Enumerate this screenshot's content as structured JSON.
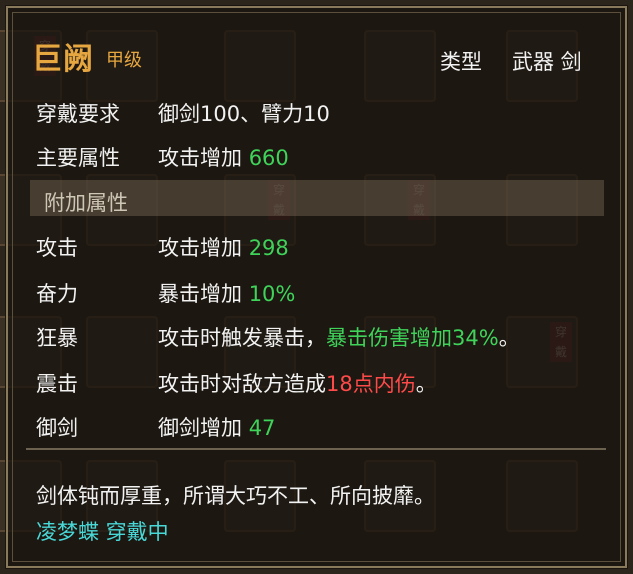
{
  "item": {
    "name": "巨阙",
    "grade": "甲级",
    "type_label": "类型",
    "type_value": "武器 剑"
  },
  "requirement": {
    "label": "穿戴要求",
    "value": "御剑100、臂力10"
  },
  "main_attr": {
    "label": "主要属性",
    "text": "攻击增加",
    "number": "660"
  },
  "bonus_section": {
    "label": "附加属性"
  },
  "bonus_attrs": [
    {
      "label": "攻击",
      "text": "攻击增加",
      "number": "298"
    },
    {
      "label": "奋力",
      "text": "暴击增加",
      "number": "10%"
    }
  ],
  "special_attrs": {
    "kuangbao": {
      "label": "狂暴",
      "prefix": "攻击时触发暴击，",
      "highlight": "暴击伤害增加34%",
      "suffix": "。"
    },
    "zhenji": {
      "label": "震击",
      "prefix": "攻击时对敌方造成",
      "highlight": "18点内伤",
      "suffix": "。"
    },
    "yujian": {
      "label": "御剑",
      "text": "御剑增加",
      "number": "47"
    }
  },
  "description": "剑体钝而厚重，所谓大巧不工、所向披靡。",
  "equipped_status": "凌梦蝶 穿戴中",
  "background_tags": [
    "穿戴",
    "穿戴",
    "穿戴",
    "穿戴"
  ],
  "colors": {
    "title": "#e6a640",
    "value_green": "#3fd35a",
    "value_red": "#ff4a4a",
    "status_cyan": "#48d8d8"
  }
}
